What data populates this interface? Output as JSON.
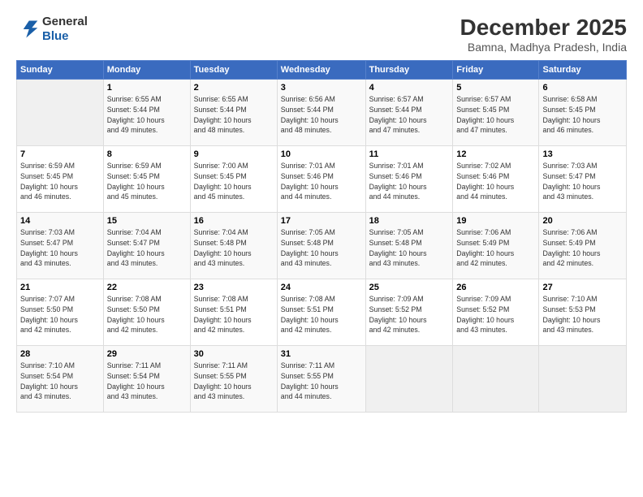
{
  "logo": {
    "line1": "General",
    "line2": "Blue"
  },
  "title": "December 2025",
  "subtitle": "Bamna, Madhya Pradesh, India",
  "days_header": [
    "Sunday",
    "Monday",
    "Tuesday",
    "Wednesday",
    "Thursday",
    "Friday",
    "Saturday"
  ],
  "weeks": [
    [
      {
        "day": "",
        "detail": ""
      },
      {
        "day": "1",
        "detail": "Sunrise: 6:55 AM\nSunset: 5:44 PM\nDaylight: 10 hours\nand 49 minutes."
      },
      {
        "day": "2",
        "detail": "Sunrise: 6:55 AM\nSunset: 5:44 PM\nDaylight: 10 hours\nand 48 minutes."
      },
      {
        "day": "3",
        "detail": "Sunrise: 6:56 AM\nSunset: 5:44 PM\nDaylight: 10 hours\nand 48 minutes."
      },
      {
        "day": "4",
        "detail": "Sunrise: 6:57 AM\nSunset: 5:44 PM\nDaylight: 10 hours\nand 47 minutes."
      },
      {
        "day": "5",
        "detail": "Sunrise: 6:57 AM\nSunset: 5:45 PM\nDaylight: 10 hours\nand 47 minutes."
      },
      {
        "day": "6",
        "detail": "Sunrise: 6:58 AM\nSunset: 5:45 PM\nDaylight: 10 hours\nand 46 minutes."
      }
    ],
    [
      {
        "day": "7",
        "detail": "Sunrise: 6:59 AM\nSunset: 5:45 PM\nDaylight: 10 hours\nand 46 minutes."
      },
      {
        "day": "8",
        "detail": "Sunrise: 6:59 AM\nSunset: 5:45 PM\nDaylight: 10 hours\nand 45 minutes."
      },
      {
        "day": "9",
        "detail": "Sunrise: 7:00 AM\nSunset: 5:45 PM\nDaylight: 10 hours\nand 45 minutes."
      },
      {
        "day": "10",
        "detail": "Sunrise: 7:01 AM\nSunset: 5:46 PM\nDaylight: 10 hours\nand 44 minutes."
      },
      {
        "day": "11",
        "detail": "Sunrise: 7:01 AM\nSunset: 5:46 PM\nDaylight: 10 hours\nand 44 minutes."
      },
      {
        "day": "12",
        "detail": "Sunrise: 7:02 AM\nSunset: 5:46 PM\nDaylight: 10 hours\nand 44 minutes."
      },
      {
        "day": "13",
        "detail": "Sunrise: 7:03 AM\nSunset: 5:47 PM\nDaylight: 10 hours\nand 43 minutes."
      }
    ],
    [
      {
        "day": "14",
        "detail": "Sunrise: 7:03 AM\nSunset: 5:47 PM\nDaylight: 10 hours\nand 43 minutes."
      },
      {
        "day": "15",
        "detail": "Sunrise: 7:04 AM\nSunset: 5:47 PM\nDaylight: 10 hours\nand 43 minutes."
      },
      {
        "day": "16",
        "detail": "Sunrise: 7:04 AM\nSunset: 5:48 PM\nDaylight: 10 hours\nand 43 minutes."
      },
      {
        "day": "17",
        "detail": "Sunrise: 7:05 AM\nSunset: 5:48 PM\nDaylight: 10 hours\nand 43 minutes."
      },
      {
        "day": "18",
        "detail": "Sunrise: 7:05 AM\nSunset: 5:48 PM\nDaylight: 10 hours\nand 43 minutes."
      },
      {
        "day": "19",
        "detail": "Sunrise: 7:06 AM\nSunset: 5:49 PM\nDaylight: 10 hours\nand 42 minutes."
      },
      {
        "day": "20",
        "detail": "Sunrise: 7:06 AM\nSunset: 5:49 PM\nDaylight: 10 hours\nand 42 minutes."
      }
    ],
    [
      {
        "day": "21",
        "detail": "Sunrise: 7:07 AM\nSunset: 5:50 PM\nDaylight: 10 hours\nand 42 minutes."
      },
      {
        "day": "22",
        "detail": "Sunrise: 7:08 AM\nSunset: 5:50 PM\nDaylight: 10 hours\nand 42 minutes."
      },
      {
        "day": "23",
        "detail": "Sunrise: 7:08 AM\nSunset: 5:51 PM\nDaylight: 10 hours\nand 42 minutes."
      },
      {
        "day": "24",
        "detail": "Sunrise: 7:08 AM\nSunset: 5:51 PM\nDaylight: 10 hours\nand 42 minutes."
      },
      {
        "day": "25",
        "detail": "Sunrise: 7:09 AM\nSunset: 5:52 PM\nDaylight: 10 hours\nand 42 minutes."
      },
      {
        "day": "26",
        "detail": "Sunrise: 7:09 AM\nSunset: 5:52 PM\nDaylight: 10 hours\nand 43 minutes."
      },
      {
        "day": "27",
        "detail": "Sunrise: 7:10 AM\nSunset: 5:53 PM\nDaylight: 10 hours\nand 43 minutes."
      }
    ],
    [
      {
        "day": "28",
        "detail": "Sunrise: 7:10 AM\nSunset: 5:54 PM\nDaylight: 10 hours\nand 43 minutes."
      },
      {
        "day": "29",
        "detail": "Sunrise: 7:11 AM\nSunset: 5:54 PM\nDaylight: 10 hours\nand 43 minutes."
      },
      {
        "day": "30",
        "detail": "Sunrise: 7:11 AM\nSunset: 5:55 PM\nDaylight: 10 hours\nand 43 minutes."
      },
      {
        "day": "31",
        "detail": "Sunrise: 7:11 AM\nSunset: 5:55 PM\nDaylight: 10 hours\nand 44 minutes."
      },
      {
        "day": "",
        "detail": ""
      },
      {
        "day": "",
        "detail": ""
      },
      {
        "day": "",
        "detail": ""
      }
    ]
  ]
}
